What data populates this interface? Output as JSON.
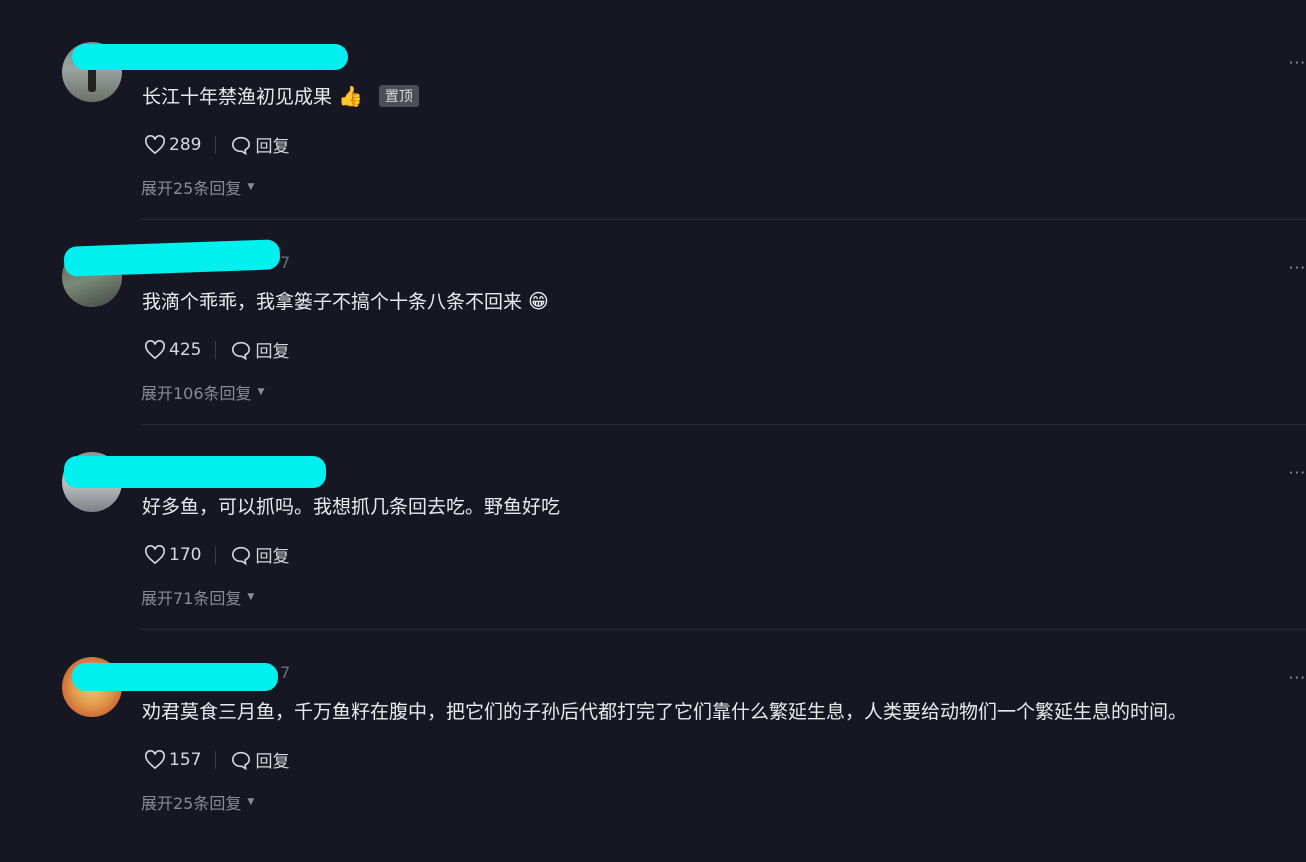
{
  "comments": [
    {
      "text": "长江十年禁渔初见成果",
      "emoji": "👍",
      "pinned": "置顶",
      "likes": "289",
      "reply": "回复",
      "expand": "展开25条回复",
      "meta": ""
    },
    {
      "text": "我滴个乖乖，我拿篓子不搞个十条八条不回来",
      "emoji": "😁",
      "pinned": "",
      "likes": "425",
      "reply": "回复",
      "expand": "展开106条回复",
      "meta": "7"
    },
    {
      "text": "好多鱼，可以抓吗。我想抓几条回去吃。野鱼好吃",
      "emoji": "",
      "pinned": "",
      "likes": "170",
      "reply": "回复",
      "expand": "展开71条回复",
      "meta": ""
    },
    {
      "text": "劝君莫食三月鱼，千万鱼籽在腹中，把它们的子孙后代都打完了它们靠什么繁延生息，人类要给动物们一个繁延生息的时间。",
      "emoji": "",
      "pinned": "",
      "likes": "157",
      "reply": "回复",
      "expand": "展开25条回复",
      "meta": "7"
    }
  ],
  "more_label": "···",
  "colors": {
    "background": "#161722",
    "redaction": "#00f0f0",
    "pin_badge": "#4c4d57"
  }
}
